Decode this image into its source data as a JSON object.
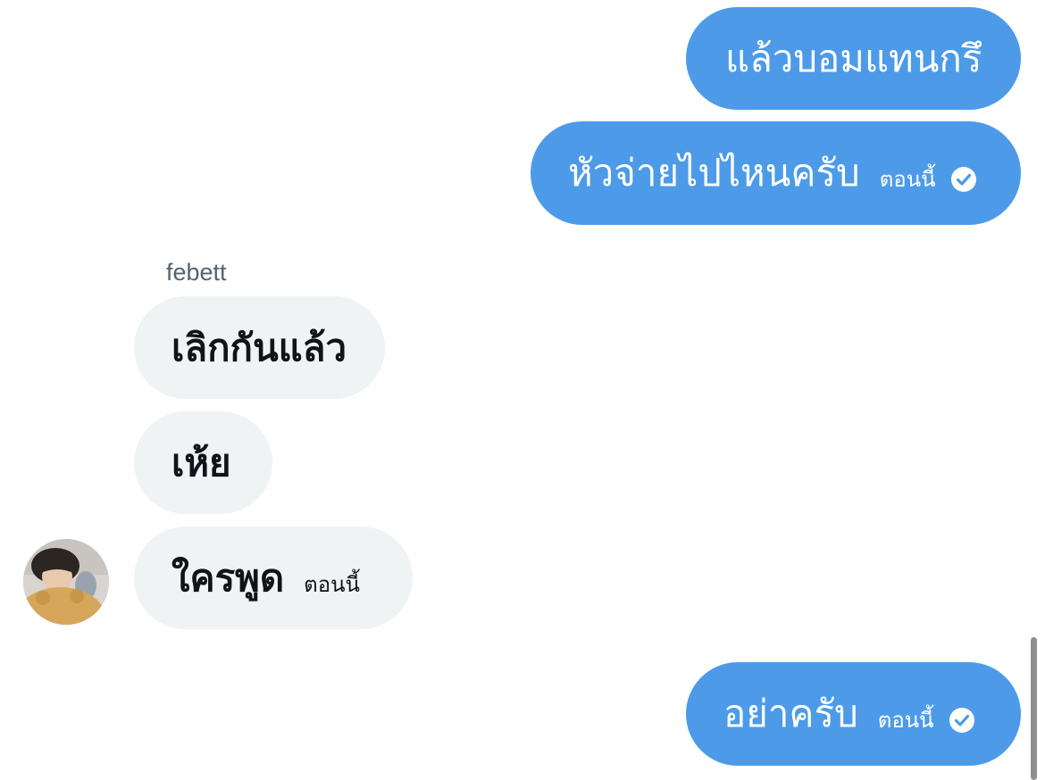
{
  "messages": [
    {
      "direction": "outgoing",
      "text": "แล้วบอมแทนกรึ"
    },
    {
      "direction": "outgoing",
      "text": "หัวจ่ายไปไหนครับ",
      "time": "ตอนนี้",
      "status_icon": "check-circle-icon"
    },
    {
      "direction": "incoming",
      "sender": "febett",
      "text": "เลิกกันแล้ว"
    },
    {
      "direction": "incoming",
      "text": "เห้ย"
    },
    {
      "direction": "incoming",
      "text": "ใครพูด",
      "time": "ตอนนี้"
    },
    {
      "direction": "outgoing",
      "text": "อย่าครับ",
      "time": "ตอนนี้",
      "status_icon": "check-circle-icon"
    }
  ],
  "colors": {
    "outgoing_bubble": "#4d9be8",
    "incoming_bubble": "#eff3f4",
    "sender_name": "#536471"
  }
}
